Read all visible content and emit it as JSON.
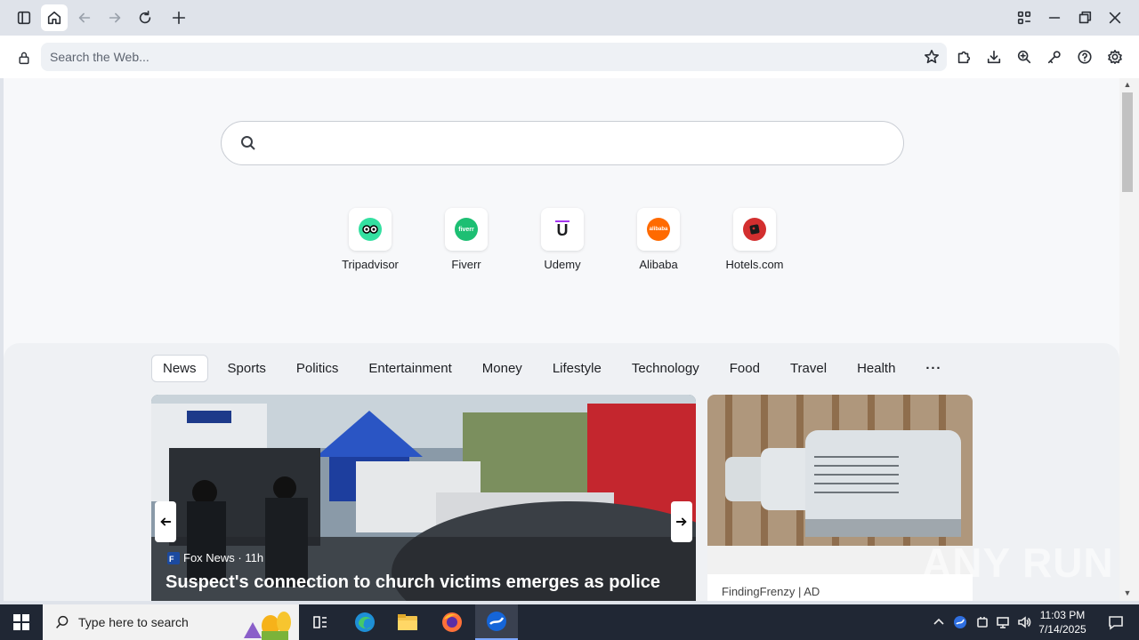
{
  "browser": {
    "address_placeholder": "Search the Web...",
    "icons": [
      "sidebar-icon",
      "home-icon",
      "back-icon",
      "forward-icon",
      "reload-icon",
      "new-tab-icon",
      "tab-grid-icon",
      "minimize-icon",
      "restore-icon",
      "close-icon",
      "lock-icon",
      "star-icon",
      "extensions-icon",
      "download-icon",
      "zoom-icon",
      "key-icon",
      "help-icon",
      "settings-icon"
    ]
  },
  "shortcuts": [
    {
      "label": "Tripadvisor",
      "color": "#34e0a1"
    },
    {
      "label": "Fiverr",
      "color": "#1dbf73"
    },
    {
      "label": "Udemy",
      "color": "#ffffff"
    },
    {
      "label": "Alibaba",
      "color": "#ff6a00"
    },
    {
      "label": "Hotels.com",
      "color": "#d32f2f"
    }
  ],
  "news": {
    "tabs": [
      "News",
      "Sports",
      "Politics",
      "Entertainment",
      "Money",
      "Lifestyle",
      "Technology",
      "Food",
      "Travel",
      "Health"
    ],
    "selected_tab": "News",
    "more_label": "···",
    "hero": {
      "source": "Fox News · 11h",
      "headline": "Suspect's connection to church victims emerges as police"
    },
    "ad": {
      "source": "FindingFrenzy | AD"
    }
  },
  "watermark": "ANY RUN",
  "taskbar": {
    "search_placeholder": "Type here to search",
    "time": "11:03 PM",
    "date": "7/14/2025"
  }
}
